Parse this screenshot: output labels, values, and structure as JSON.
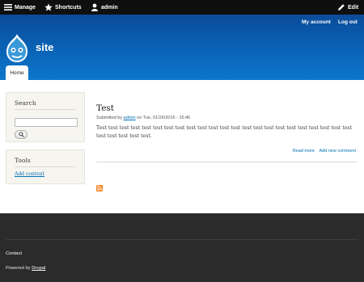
{
  "toolbar": {
    "manage": "Manage",
    "shortcuts": "Shortcuts",
    "user": "admin",
    "edit": "Edit"
  },
  "secondary_menu": {
    "my_account": "My account",
    "log_out": "Log out"
  },
  "site": {
    "name": "site"
  },
  "tabs": {
    "home": "Home"
  },
  "sidebar": {
    "search": {
      "title": "Search",
      "value": ""
    },
    "tools": {
      "title": "Tools",
      "add_content": "Add content"
    }
  },
  "node": {
    "title": "Test",
    "submitted_prefix": "Submitted by",
    "author": "admin",
    "submitted_suffix": "on Tue, 01/26/2016 - 15:46",
    "body": "Test test test test test test test test test test test test test test test test test test test test test test test test test test test test.",
    "read_more": "Read more",
    "add_comment": "Add new comment"
  },
  "footer": {
    "contact": "Contact",
    "powered_prefix": "Powered by",
    "powered_link": "Drupal"
  },
  "colors": {
    "toolbar_bg": "#0f0f0f",
    "header_blue": "#0a63b6",
    "link_blue": "#0071b3",
    "footer_bg": "#2b2b2b",
    "feed_orange": "#f78422"
  }
}
